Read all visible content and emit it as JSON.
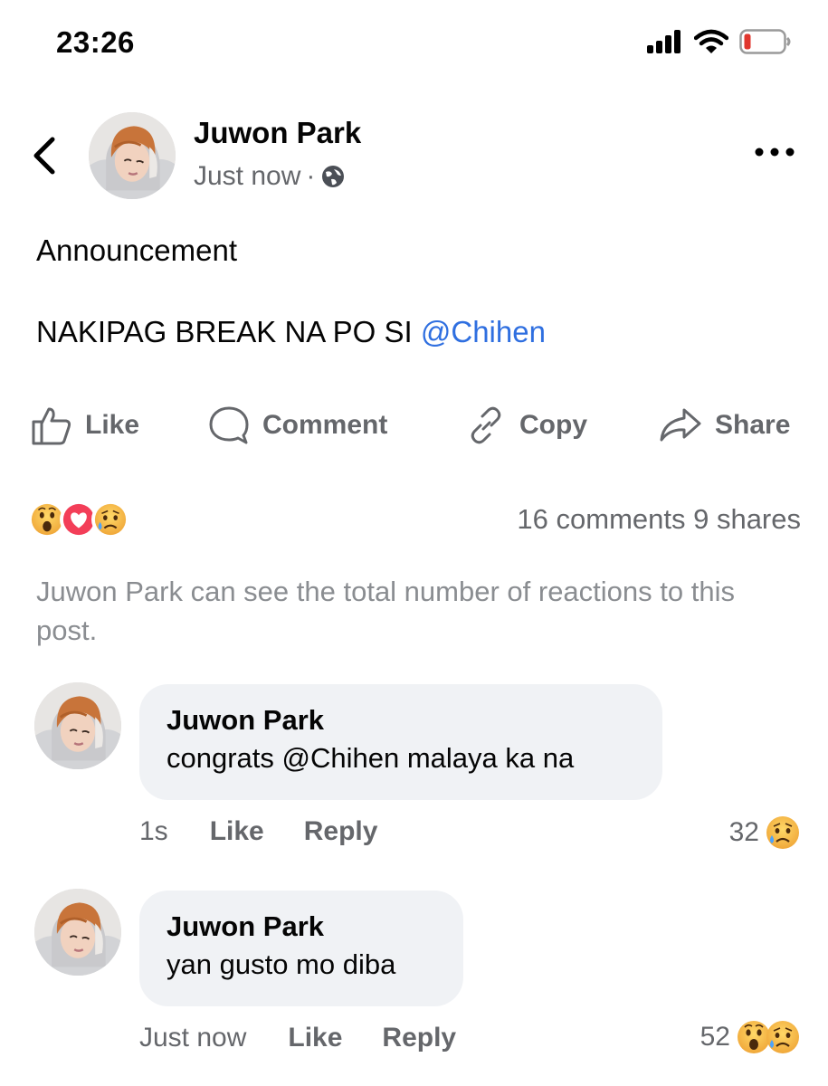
{
  "status_bar": {
    "time": "23:26",
    "icons": [
      "cellular-signal-icon",
      "wifi-icon",
      "battery-low-icon"
    ],
    "battery_color": "#e0362d"
  },
  "post": {
    "author": "Juwon Park",
    "timestamp": "Just now",
    "separator": "·",
    "privacy_icon": "globe-icon",
    "title": "Announcement",
    "body_prefix": "NAKIPAG BREAK NA PO SI ",
    "mention": "@Chihen",
    "mention_color": "#2f6fe0"
  },
  "actions": {
    "like": "Like",
    "comment": "Comment",
    "copy": "Copy",
    "share": "Share"
  },
  "reactions": {
    "emojis": [
      "wow-emoji",
      "love-emoji",
      "sad-emoji"
    ],
    "counts_text": "16 comments 9 shares",
    "notice": "Juwon Park can see the total number of reactions to this post."
  },
  "comments": [
    {
      "author": "Juwon Park",
      "text": "congrats @Chihen malaya ka na",
      "time": "1s",
      "like": "Like",
      "reply": "Reply",
      "reaction_count": "32",
      "reaction_emojis": [
        "sad-emoji"
      ]
    },
    {
      "author": "Juwon Park",
      "text": "yan gusto mo diba",
      "time": "Just now",
      "like": "Like",
      "reply": "Reply",
      "reaction_count": "52",
      "reaction_emojis": [
        "wow-emoji",
        "sad-emoji"
      ]
    }
  ],
  "colors": {
    "secondary_text": "#65676b",
    "bubble_bg": "#f0f2f5",
    "love_red": "#f33e58",
    "emoji_yellow": "#f7c04a"
  }
}
